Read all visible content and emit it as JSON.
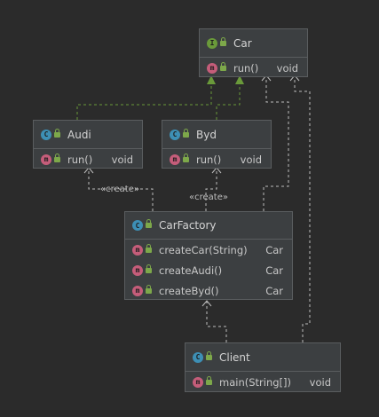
{
  "nodes": {
    "car": {
      "badge": "I",
      "title": "Car",
      "methods": [
        {
          "name": "run()",
          "ret": "void"
        }
      ]
    },
    "audi": {
      "badge": "C",
      "title": "Audi",
      "methods": [
        {
          "name": "run()",
          "ret": "void"
        }
      ]
    },
    "byd": {
      "badge": "C",
      "title": "Byd",
      "methods": [
        {
          "name": "run()",
          "ret": "void"
        }
      ]
    },
    "carfactory": {
      "badge": "C",
      "title": "CarFactory",
      "methods": [
        {
          "name": "createCar(String)",
          "ret": "Car"
        },
        {
          "name": "createAudi()",
          "ret": "Car"
        },
        {
          "name": "createByd()",
          "ret": "Car"
        }
      ]
    },
    "client": {
      "badge": "C",
      "title": "Client",
      "methods": [
        {
          "name": "main(String[])",
          "ret": "void"
        }
      ]
    }
  },
  "method_badge": "m",
  "labels": {
    "create_audi": "«create»",
    "create_byd": "«create»"
  },
  "colors": {
    "background": "#2b2b2b",
    "node": "#3c3f41",
    "interface_badge": "#6a9a3a",
    "class_badge": "#3d8fb5",
    "method_badge": "#c55d7a",
    "implements_edge": "#6a9a3a",
    "dependency_edge": "#bdbdbd"
  }
}
